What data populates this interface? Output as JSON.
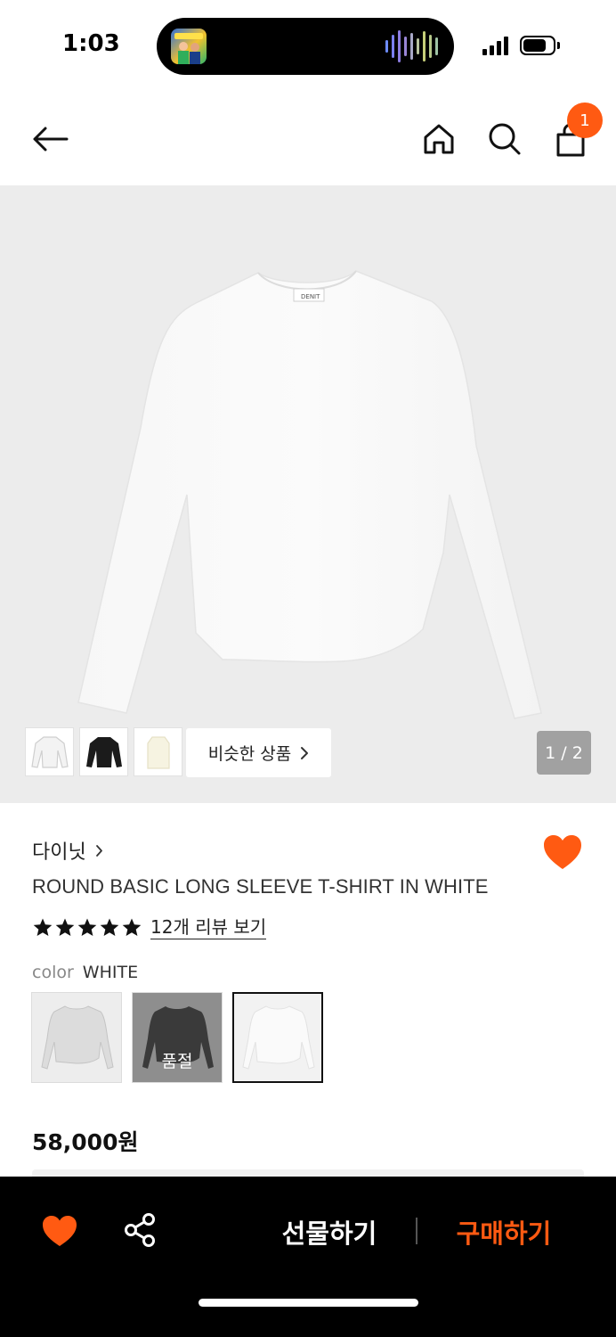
{
  "status_bar": {
    "time": "1:03"
  },
  "header": {
    "cart_count": "1"
  },
  "gallery": {
    "similar_label": "비슷한 상품",
    "page_counter": "1 / 2"
  },
  "product": {
    "brand": "다이닛",
    "title": "ROUND BASIC LONG SLEEVE T-SHIRT IN WHITE",
    "rating_stars": 5,
    "review_link": "12개 리뷰 보기",
    "color_label": "color",
    "color_value": "WHITE",
    "soldout_label": "품절",
    "price": "58,000원"
  },
  "bottom_bar": {
    "gift_label": "선물하기",
    "buy_label": "구매하기"
  },
  "colors": {
    "accent": "#ff5a12",
    "bottom_bar_bg": "#000000",
    "image_bg": "#ececec"
  }
}
